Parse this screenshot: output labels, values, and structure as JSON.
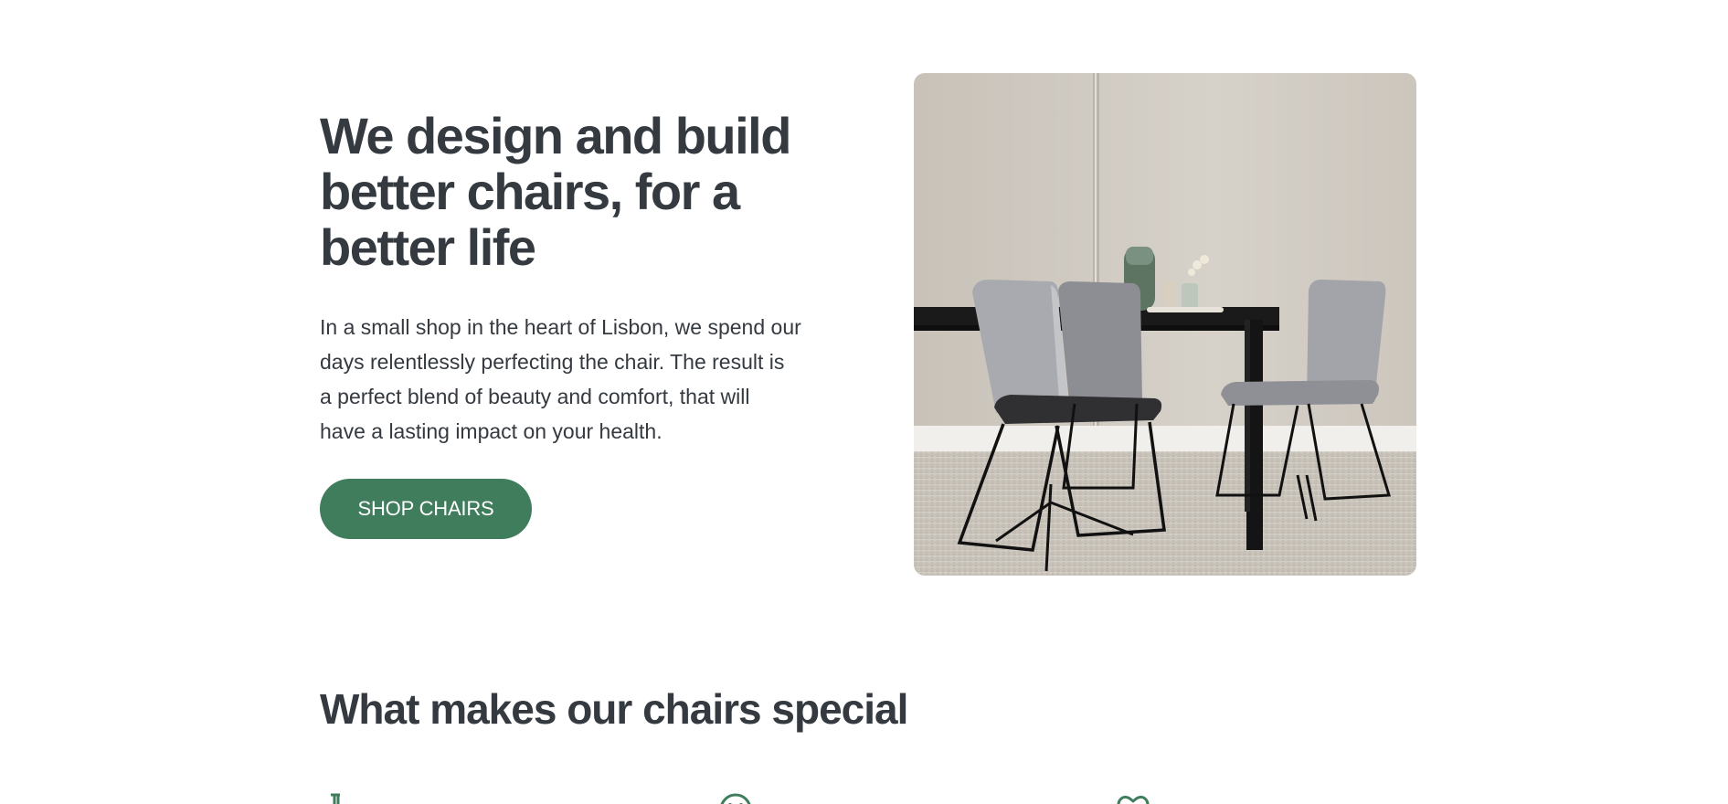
{
  "hero": {
    "title_lines": [
      "We design and build",
      "better chairs, for a",
      "better life"
    ],
    "description_lines": [
      "In a small shop in the heart of Lisbon, we spend our",
      "days relentlessly perfecting the chair. The result is",
      "a perfect blend of beauty and comfort, that will",
      "have a lasting impact on your health."
    ],
    "cta_label": "SHOP CHAIRS",
    "image_alt": "Grey upholstered chairs around a black dining table"
  },
  "features": {
    "title": "What makes our chairs special",
    "icons": [
      "flask-icon",
      "smile-icon",
      "heart-icon"
    ]
  },
  "colors": {
    "text": "#343a40",
    "accent": "#3f7d5c",
    "background": "#ffffff"
  }
}
